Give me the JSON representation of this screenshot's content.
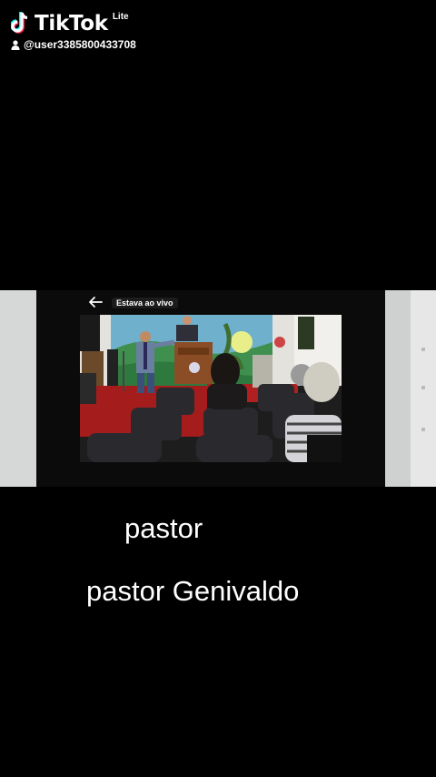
{
  "watermark": {
    "brand": "TikTok",
    "badge": "Lite",
    "username": "@user3385800433708",
    "icons": [
      "tiktok-note-icon",
      "user-icon"
    ]
  },
  "player": {
    "live_label": "Estava ao vivo",
    "back_icon": "arrow-left-icon"
  },
  "captions": [
    "pastor",
    "pastor Genivaldo"
  ]
}
